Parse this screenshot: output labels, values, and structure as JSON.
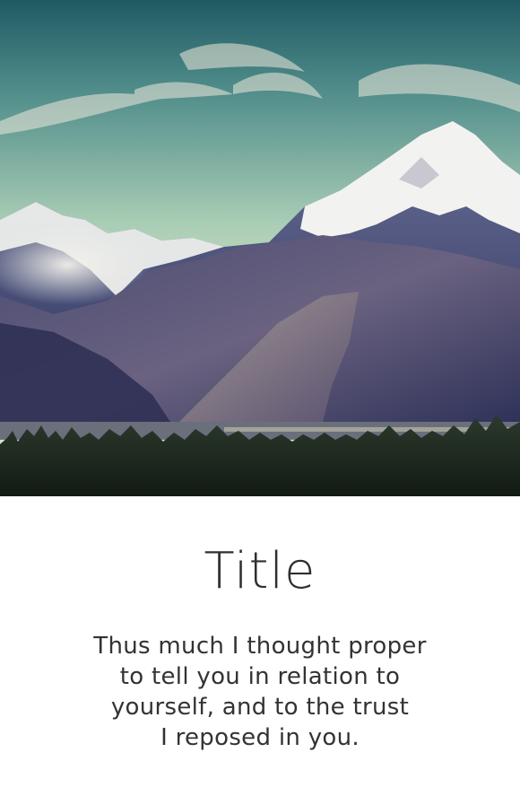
{
  "card": {
    "image": {
      "description": "mountain-landscape",
      "colors": {
        "sky_top": "#2f6e73",
        "sky_mid": "#7fb2a6",
        "sky_low": "#b9d5b6",
        "mountain": "#3b3f63",
        "snow": "#f2f3f0",
        "forest": "#1c2a22"
      }
    },
    "title": "Title",
    "body_lines": [
      "Thus much I thought proper",
      "to tell you in relation to",
      "yourself, and to the trust",
      "I reposed in you."
    ]
  }
}
